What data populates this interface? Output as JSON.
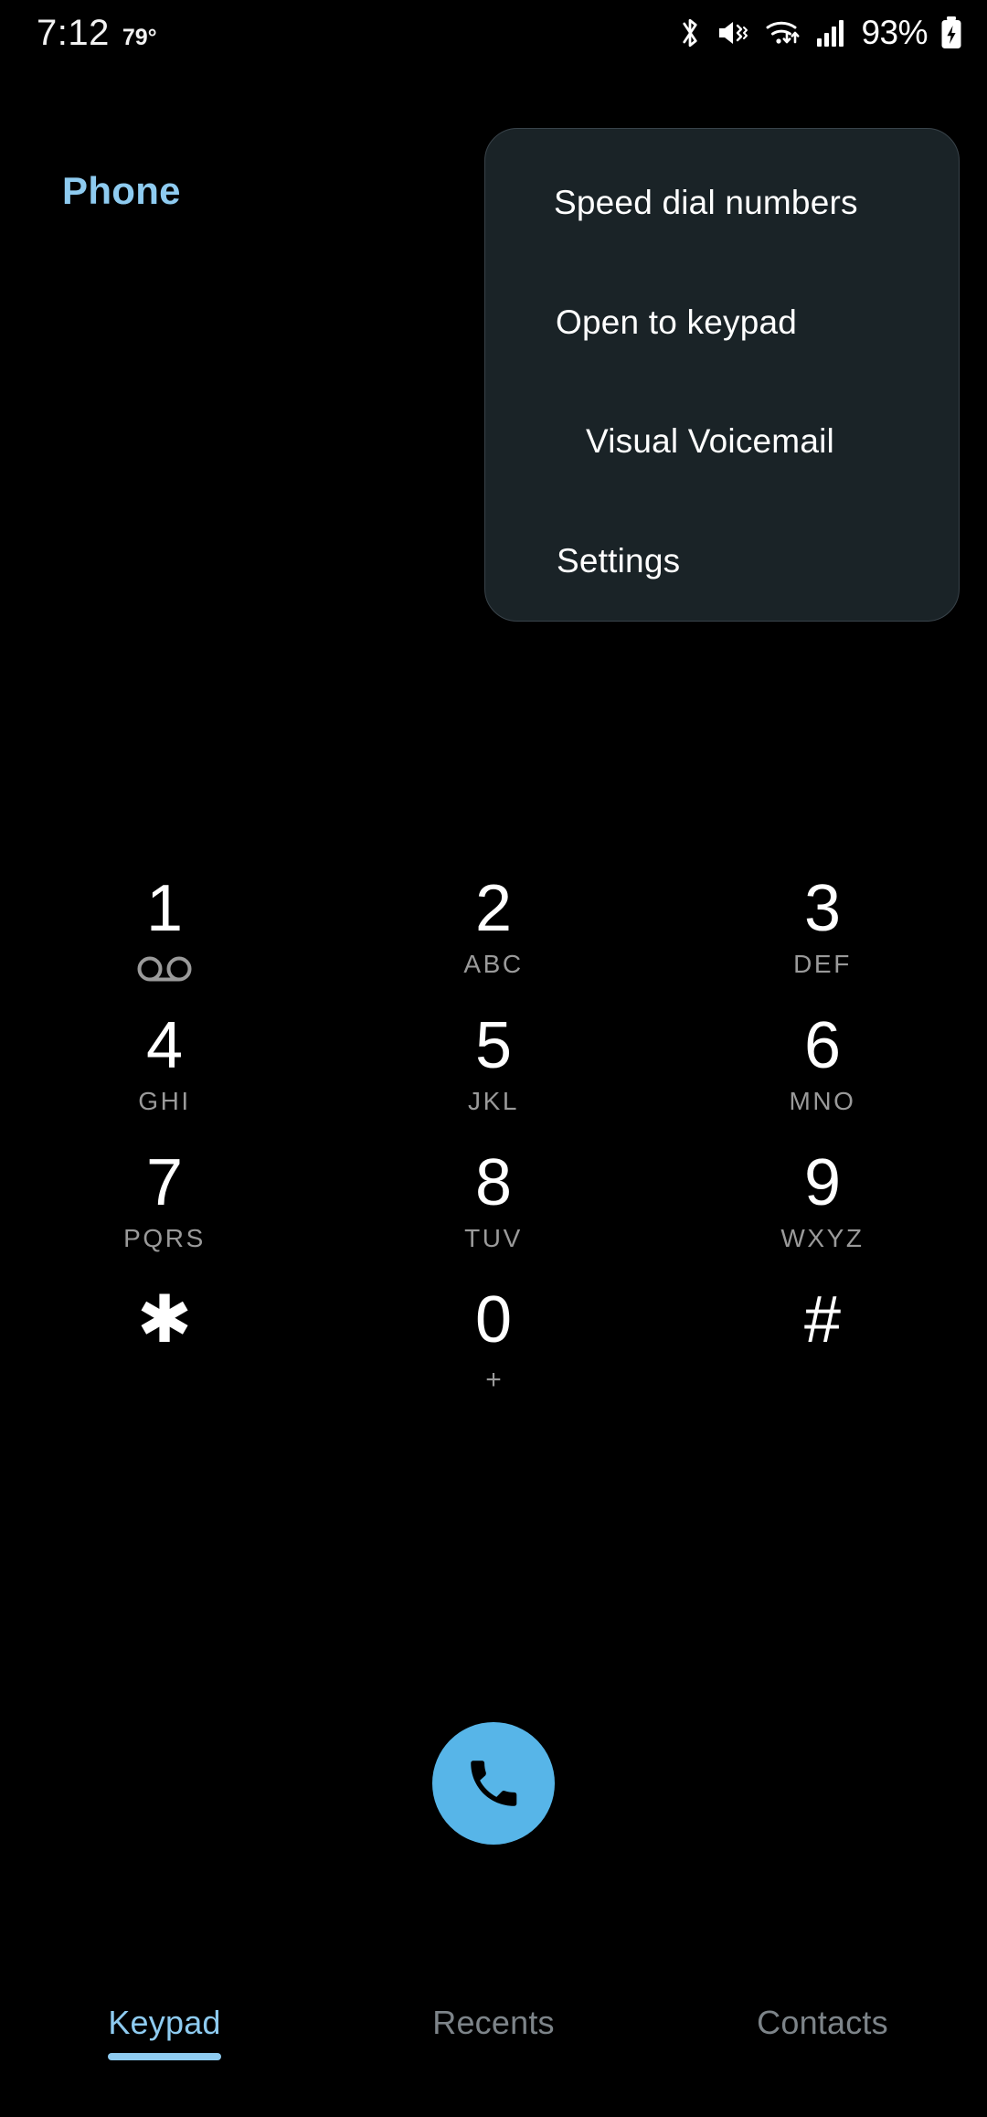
{
  "status_bar": {
    "time": "7:12",
    "temperature": "79°",
    "battery_percent": "93%",
    "icons": [
      "bluetooth-icon",
      "sound-mute-vibrate-icon",
      "wifi-data-icon",
      "cellular-signal-icon",
      "battery-charging-icon"
    ]
  },
  "header": {
    "title": "Phone"
  },
  "overflow_menu": {
    "visible": true,
    "background_color": "#1a2327",
    "items": [
      {
        "label": "Speed dial numbers"
      },
      {
        "label": "Open to keypad"
      },
      {
        "label": "Visual Voicemail"
      },
      {
        "label": "Settings"
      }
    ]
  },
  "keypad": {
    "keys": [
      {
        "digit": "1",
        "sub": "",
        "icon": "voicemail-icon",
        "name": "key-1"
      },
      {
        "digit": "2",
        "sub": "ABC",
        "icon": "",
        "name": "key-2"
      },
      {
        "digit": "3",
        "sub": "DEF",
        "icon": "",
        "name": "key-3"
      },
      {
        "digit": "4",
        "sub": "GHI",
        "icon": "",
        "name": "key-4"
      },
      {
        "digit": "5",
        "sub": "JKL",
        "icon": "",
        "name": "key-5"
      },
      {
        "digit": "6",
        "sub": "MNO",
        "icon": "",
        "name": "key-6"
      },
      {
        "digit": "7",
        "sub": "PQRS",
        "icon": "",
        "name": "key-7"
      },
      {
        "digit": "8",
        "sub": "TUV",
        "icon": "",
        "name": "key-8"
      },
      {
        "digit": "9",
        "sub": "WXYZ",
        "icon": "",
        "name": "key-9"
      },
      {
        "digit": "✱",
        "sub": "",
        "icon": "",
        "name": "key-star"
      },
      {
        "digit": "0",
        "sub": "+",
        "icon": "",
        "name": "key-0"
      },
      {
        "digit": "#",
        "sub": "",
        "icon": "",
        "name": "key-pound"
      }
    ]
  },
  "call_button": {
    "icon": "phone-handset-icon",
    "color": "#57b5e8"
  },
  "tabs": [
    {
      "label": "Keypad",
      "active": true
    },
    {
      "label": "Recents",
      "active": false
    },
    {
      "label": "Contacts",
      "active": false
    }
  ],
  "colors": {
    "accent": "#8ecbf0",
    "call_button": "#57b5e8",
    "menu_bg": "#1a2327",
    "background": "#000000",
    "sub_label": "#9a9a9a",
    "inactive_tab": "#7d8489"
  }
}
